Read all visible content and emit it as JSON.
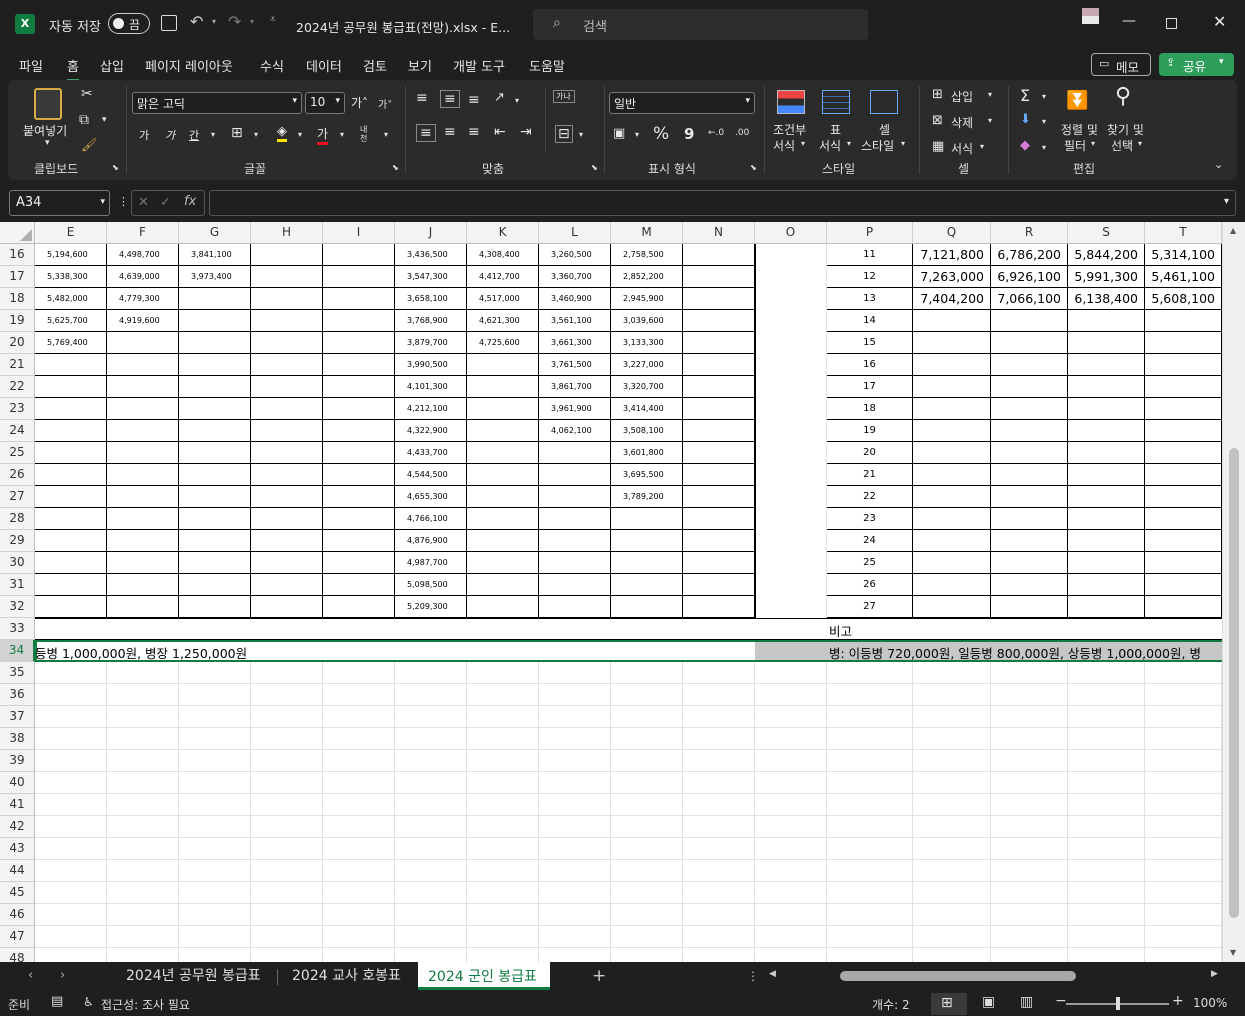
{
  "titlebar": {
    "autosave_label": "자동 저장",
    "autosave_state": "끔",
    "filename": "2024년 공무원 봉급표(전망).xlsx  -  E...",
    "search_placeholder": "검색"
  },
  "menu": {
    "items": [
      "파일",
      "홈",
      "삽입",
      "페이지 레이아웃",
      "수식",
      "데이터",
      "검토",
      "보기",
      "개발 도구",
      "도움말"
    ],
    "memo_label": "메모",
    "share_label": "공유"
  },
  "ribbon": {
    "clipboard": {
      "paste": "붙여넣기",
      "group": "클립보드"
    },
    "font": {
      "name": "맑은 고딕",
      "size": "10",
      "grow": "가˄",
      "shrink": "가˅",
      "bold": "가",
      "italic": "가",
      "underline": "간",
      "color_a": "가",
      "phonetic": "내천",
      "group": "글꼴"
    },
    "align": {
      "wrap": "가나",
      "group": "맞춤"
    },
    "number": {
      "format": "일반",
      "pct": "%",
      "comma": "9",
      "inc": "←.0",
      "dec": ".00",
      "group": "표시 형식"
    },
    "styles": {
      "cond1": "조건부",
      "cond2": "서식",
      "table1": "표",
      "table2": "서식",
      "cell1": "셀",
      "cell2": "스타일",
      "group": "스타일"
    },
    "cells": {
      "insert": "삽입",
      "delete": "삭제",
      "format": "서식",
      "group": "셀"
    },
    "edit": {
      "sort1": "정렬 및",
      "sort2": "필터",
      "find1": "찾기 및",
      "find2": "선택",
      "group": "편집"
    }
  },
  "formula_bar": {
    "name_box": "A34",
    "fx": "fx",
    "value": ""
  },
  "columns": [
    "E",
    "F",
    "G",
    "H",
    "I",
    "J",
    "K",
    "L",
    "M",
    "N",
    "O",
    "P",
    "Q",
    "R",
    "S",
    "T"
  ],
  "rows": [
    "16",
    "17",
    "18",
    "19",
    "20",
    "21",
    "22",
    "23",
    "24",
    "25",
    "26",
    "27",
    "28",
    "29",
    "30",
    "31",
    "32",
    "33",
    "34",
    "35",
    "36",
    "37",
    "38",
    "39",
    "40",
    "41",
    "42",
    "43",
    "44",
    "45",
    "46",
    "47",
    "48"
  ],
  "cells": {
    "E": [
      "5,194,600",
      "5,338,300",
      "5,482,000",
      "5,625,700",
      "5,769,400"
    ],
    "F": [
      "4,498,700",
      "4,639,000",
      "4,779,300",
      "4,919,600"
    ],
    "G": [
      "3,841,100",
      "3,973,400"
    ],
    "J": [
      "3,436,500",
      "3,547,300",
      "3,658,100",
      "3,768,900",
      "3,879,700",
      "3,990,500",
      "4,101,300",
      "4,212,100",
      "4,322,900",
      "4,433,700",
      "4,544,500",
      "4,655,300",
      "4,766,100",
      "4,876,900",
      "4,987,700",
      "5,098,500",
      "5,209,300"
    ],
    "K": [
      "4,308,400",
      "4,412,700",
      "4,517,000",
      "4,621,300",
      "4,725,600"
    ],
    "L": [
      "3,260,500",
      "3,360,700",
      "3,460,900",
      "3,561,100",
      "3,661,300",
      "3,761,500",
      "3,861,700",
      "3,961,900",
      "4,062,100"
    ],
    "M": [
      "2,758,500",
      "2,852,200",
      "2,945,900",
      "3,039,600",
      "3,133,300",
      "3,227,000",
      "3,320,700",
      "3,414,400",
      "3,508,100",
      "3,601,800",
      "3,695,500",
      "3,789,200"
    ],
    "P": [
      "11",
      "12",
      "13",
      "14",
      "15",
      "16",
      "17",
      "18",
      "19",
      "20",
      "21",
      "22",
      "23",
      "24",
      "25",
      "26",
      "27"
    ],
    "Q": [
      "7,121,800",
      "7,263,000",
      "7,404,200"
    ],
    "R": [
      "6,786,200",
      "6,926,100",
      "7,066,100"
    ],
    "S": [
      "5,844,200",
      "5,991,300",
      "6,138,400"
    ],
    "T": [
      "5,314,100",
      "5,461,100",
      "5,608,100"
    ]
  },
  "row33_note": "비고",
  "row34_left": "등병  1,000,000원, 병장  1,250,000원",
  "row34_right": "병: 이등병  720,000원, 일등병  800,000원, 상등병  1,000,000원, 병",
  "sheets": [
    "2024년 공무원 봉급표",
    "2024 교사 호봉표",
    "2024 군인 봉급표"
  ],
  "active_sheet": "2024 군인 봉급표",
  "status": {
    "ready": "준비",
    "accessibility": "접근성: 조사 필요",
    "count": "개수: 2",
    "zoom": "100%"
  },
  "colors": {
    "accent_green": "#107c41",
    "share_btn": "#2e9e5b",
    "selection": "#c6c6c6"
  }
}
